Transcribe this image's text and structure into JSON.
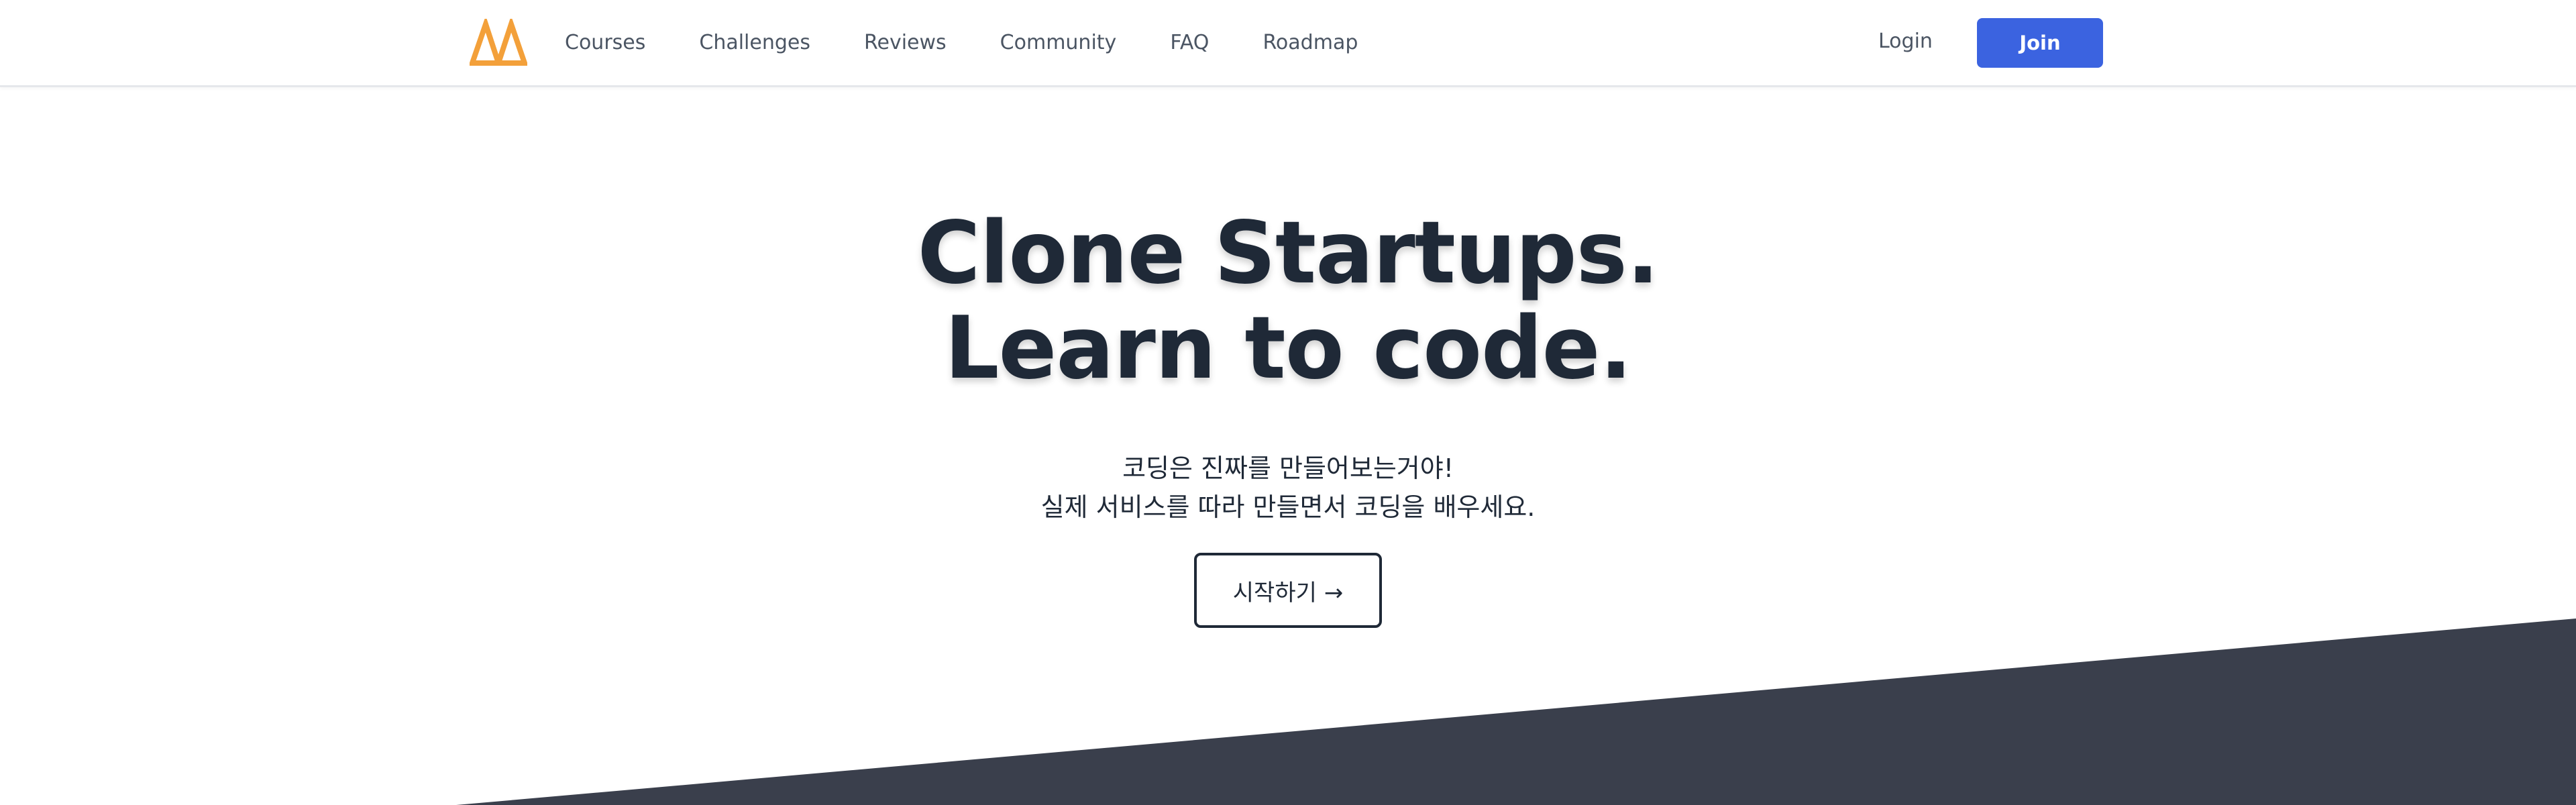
{
  "nav": {
    "logo_icon": "orange-m-logo-icon",
    "links": [
      "Courses",
      "Challenges",
      "Reviews",
      "Community",
      "FAQ",
      "Roadmap"
    ],
    "login": "Login",
    "join": "Join"
  },
  "hero": {
    "title_line_1": "Clone Startups.",
    "title_line_2": "Learn to code.",
    "subtitle_line_1": "코딩은 진짜를 만들어보는거야!",
    "subtitle_line_2": "실제 서비스를 따라 만들면서 코딩을 배우세요.",
    "cta": "시작하기 →"
  },
  "colors": {
    "accent": "#3b63e0",
    "logo": "#f3a03a",
    "dark_section": "#3a3f4c",
    "heading": "#1f2937"
  }
}
